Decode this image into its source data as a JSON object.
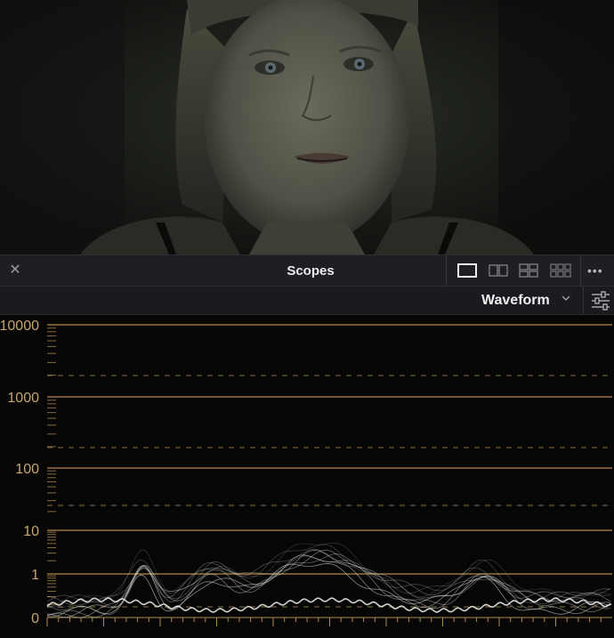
{
  "viewer": {
    "image": "movie-frame-woman-portrait"
  },
  "header": {
    "title": "Scopes",
    "close_icon": "close-icon",
    "layout_buttons": [
      "layout-single-icon",
      "layout-dual-icon",
      "layout-quad-icon",
      "layout-grid-icon"
    ],
    "more_icon": "more-icon"
  },
  "subheader": {
    "mode": "Waveform",
    "settings_icon": "sliders-icon"
  },
  "scope": {
    "colors": {
      "grid": "#b08a4a",
      "trace": "#e8ede2",
      "label": "#c9a66a"
    },
    "chart_data": {
      "type": "line",
      "title": "",
      "xlabel": "",
      "ylabel": "",
      "y_scale": "log",
      "y_ticks": [
        "10000",
        "1000",
        "100",
        "10",
        "1",
        "0"
      ],
      "grid": true
    }
  }
}
